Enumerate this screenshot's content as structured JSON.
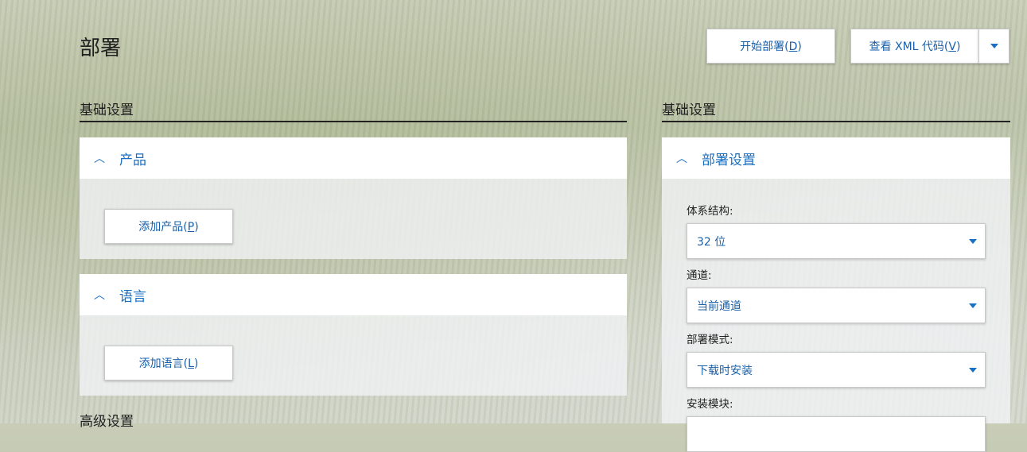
{
  "page": {
    "title": "部署"
  },
  "toolbar": {
    "start_deploy": {
      "text": "开始部署(",
      "key": "D",
      "end": ")"
    },
    "view_xml": {
      "text": "查看 XML 代码(",
      "key": "V",
      "end": ")"
    },
    "dropdown_icon": "chevron-down-icon"
  },
  "left": {
    "section_title": "基础设置",
    "products": {
      "header": "产品",
      "button": {
        "text": "添加产品(",
        "key": "P",
        "end": ")"
      }
    },
    "languages": {
      "header": "语言",
      "button": {
        "text": "添加语言(",
        "key": "L",
        "end": ")"
      }
    },
    "advanced_title": "高级设置"
  },
  "right": {
    "section_title": "基础设置",
    "deploy_settings": {
      "header": "部署设置",
      "fields": [
        {
          "label": "体系结构:",
          "value": "32 位"
        },
        {
          "label": "通道:",
          "value": "当前通道"
        },
        {
          "label": "部署模式:",
          "value": "下载时安装"
        },
        {
          "label": "安装模块:",
          "value": ""
        }
      ]
    }
  },
  "colors": {
    "accent": "#1a6fc0",
    "text": "#1f1f1f"
  }
}
